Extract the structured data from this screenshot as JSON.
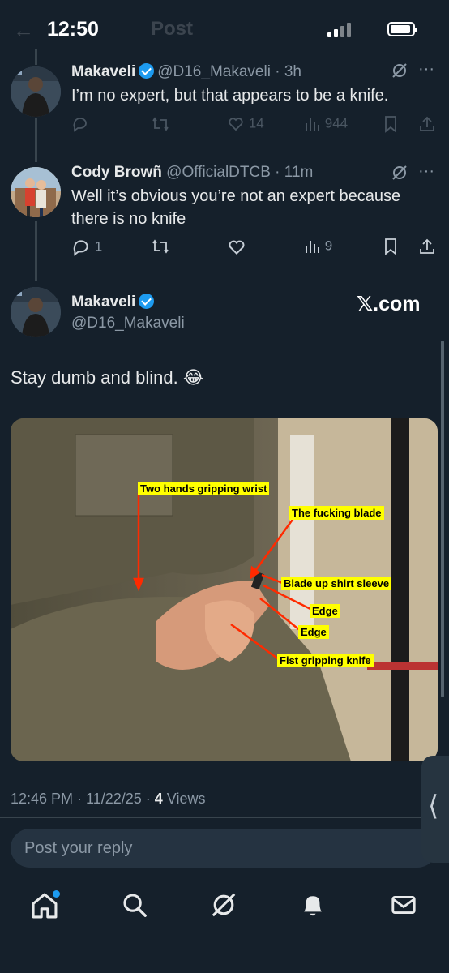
{
  "status_bar": {
    "time": "12:50"
  },
  "header": {
    "title": "Post"
  },
  "replies": [
    {
      "name": "Makaveli",
      "handle": "@D16_Makaveli",
      "time": "3h",
      "text": "I’m no expert, but that appears to be a knife.",
      "likes": "14",
      "views": "944"
    },
    {
      "name": "Cody Browñ",
      "handle": "@OfficialDTCB",
      "time": "11m",
      "text_line1": "Well it’s obvious you’re not an expert because",
      "text_line2": "there is no knife",
      "replies": "1",
      "views": "9"
    }
  ],
  "main_post": {
    "name": "Makaveli",
    "handle": "@D16_Makaveli",
    "watermark": "𝕏.com",
    "text": "Stay dumb and blind. 😂",
    "annotations": [
      "Two hands gripping wrist",
      "The fucking blade",
      "Blade up shirt sleeve",
      "Edge",
      "Edge",
      "Fist gripping knife"
    ],
    "timestamp": "12:46 PM · 11/22/25 · ",
    "views_count": "4",
    "views_label": " Views"
  },
  "reply_box": {
    "placeholder": "Post your reply"
  },
  "side_tab": {
    "glyph": "⟨"
  },
  "bottom_nav": [
    "home-icon",
    "search-icon",
    "grok-icon",
    "notifications-icon",
    "messages-icon"
  ],
  "colors": {
    "background": "#15202b",
    "accent": "#1d9bf0",
    "muted": "#8b98a5",
    "callout": "#ffff00",
    "arrow": "#ff2a00"
  }
}
